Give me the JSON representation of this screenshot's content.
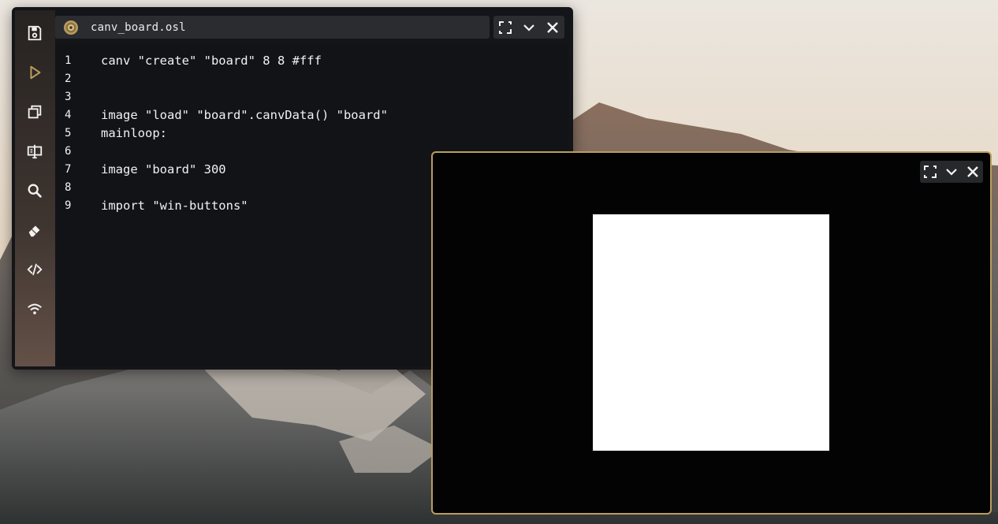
{
  "editor": {
    "title": "canv_board.osl",
    "lines": [
      {
        "num": "1",
        "text": "canv \"create\" \"board\" 8 8 #fff"
      },
      {
        "num": "2",
        "text": ""
      },
      {
        "num": "3",
        "text": ""
      },
      {
        "num": "4",
        "text": "image \"load\" \"board\".canvData() \"board\""
      },
      {
        "num": "5",
        "text": "mainloop:"
      },
      {
        "num": "6",
        "text": ""
      },
      {
        "num": "7",
        "text": "image \"board\" 300"
      },
      {
        "num": "8",
        "text": ""
      },
      {
        "num": "9",
        "text": "import \"win-buttons\""
      }
    ]
  },
  "sidebar": {
    "icons": [
      "save-icon",
      "run-icon",
      "windows-icon",
      "terminal-icon",
      "search-icon",
      "eraser-icon",
      "code-icon",
      "wifi-icon"
    ],
    "active_color": "#b99d5e"
  },
  "output": {
    "canvas_color": "#ffffff",
    "border_color": "#b99d5e"
  }
}
